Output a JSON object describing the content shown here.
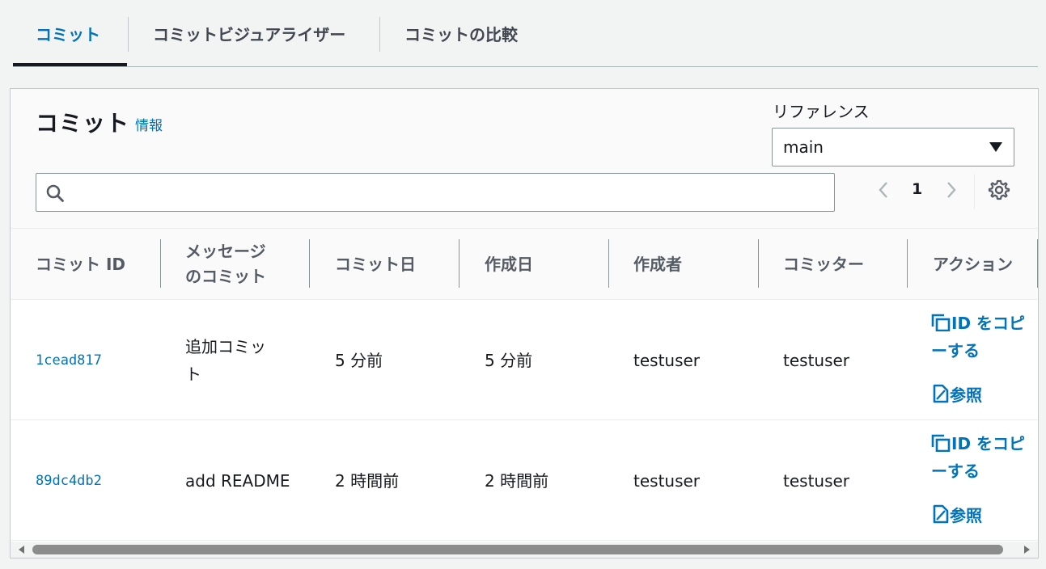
{
  "tabs": [
    {
      "label": "コミット",
      "active": true
    },
    {
      "label": "コミットビジュアライザー",
      "active": false
    },
    {
      "label": "コミットの比較",
      "active": false
    }
  ],
  "panel": {
    "title": "コミット",
    "info_link": "情報",
    "reference_label": "リファレンス",
    "reference_value": "main",
    "search_placeholder": "",
    "page_number": "1"
  },
  "table": {
    "columns": [
      "コミット ID",
      "メッセージのコミット",
      "コミット日",
      "作成日",
      "作成者",
      "コミッター",
      "アクション"
    ],
    "column_lines": {
      "message": [
        "メッセージ",
        "のコミット"
      ]
    },
    "rows": [
      {
        "id": "1cead817",
        "message_lines": [
          "追加コミッ",
          "ト"
        ],
        "commit_date": "5 分前",
        "created_date": "5 分前",
        "author": "testuser",
        "committer": "testuser",
        "copy_lines": [
          "ID をコピ",
          "ーする"
        ],
        "view": "参照"
      },
      {
        "id": "89dc4db2",
        "message_lines": [
          "add README"
        ],
        "commit_date": "2 時間前",
        "created_date": "2 時間前",
        "author": "testuser",
        "committer": "testuser",
        "copy_lines": [
          "ID をコピ",
          "ーする"
        ],
        "view": "参照"
      }
    ]
  },
  "icons": {
    "search": "search-icon",
    "prev": "chevron-left-icon",
    "next": "chevron-right-icon",
    "settings": "gear-icon",
    "caret": "caret-down-icon",
    "copy": "copy-icon",
    "view": "file-icon"
  },
  "colors": {
    "link": "#0073bb",
    "active_tab": "#0073bb",
    "text": "#16191f",
    "header_text": "#545b64"
  }
}
